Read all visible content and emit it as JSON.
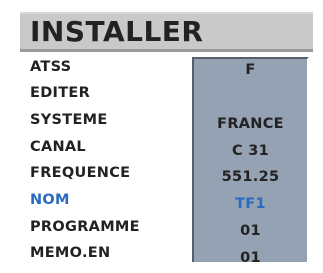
{
  "menu": {
    "title": "INSTALLER",
    "rows": [
      {
        "label": "ATSS",
        "value": "F"
      },
      {
        "label": "EDITER",
        "value": ""
      },
      {
        "label": "SYSTEME",
        "value": "FRANCE"
      },
      {
        "label": "CANAL",
        "value": "C 31"
      },
      {
        "label": "FREQUENCE",
        "value": "551.25"
      },
      {
        "label": "NOM",
        "value": "TF1",
        "selected": true
      },
      {
        "label": "PROGRAMME",
        "value": "01"
      },
      {
        "label": "MEMO.EN",
        "value": "01"
      }
    ]
  },
  "colors": {
    "title_bar": "#c9c9c9",
    "panel": "#94a2b3",
    "selected_text": "#2a6bc2",
    "text": "#222222"
  }
}
